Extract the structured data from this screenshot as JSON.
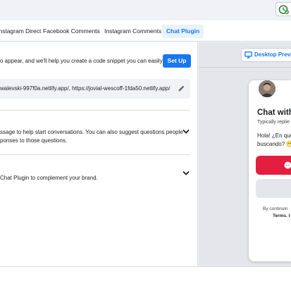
{
  "tabs": [
    {
      "label": "Instagram Direct"
    },
    {
      "label": "Facebook Comments"
    },
    {
      "label": "Instagram Comments"
    },
    {
      "label": "Chat Plugin"
    }
  ],
  "setup": {
    "text": "o appear, and we'll help you create a code snippet you can easily",
    "button": "Set Up"
  },
  "domains": {
    "text": "walevski-997f0a.netlify.app/, https://jovial-wescoff-1fda50.netlify.app/"
  },
  "section_greeting": {
    "line1": "ssage to help start conversations. You can also suggest questions people",
    "line2": "ponses to those questions."
  },
  "section_appearance": {
    "line1": "Chat Plugin to complement your brand."
  },
  "preview": {
    "button": "Desktop Preview",
    "card_title": "Chat with",
    "card_sub": "Typically replie",
    "message_line1": "Hola! ¿En que",
    "message_line2": "buscando? 😁",
    "fine_line1": "By continuin",
    "fine_line2": "Terms. I"
  },
  "colors": {
    "accent": "#1877f2",
    "messenger_button": "#e41e3f"
  },
  "icons": [
    "update-icon",
    "pencil-icon",
    "chevron-down-icon",
    "desktop-icon",
    "messenger-icon"
  ]
}
